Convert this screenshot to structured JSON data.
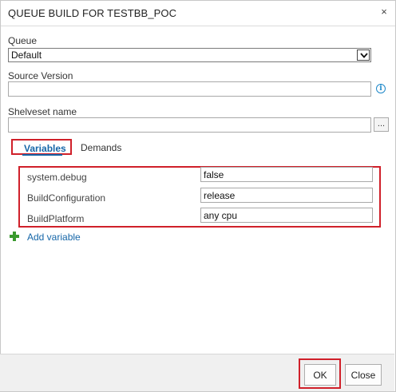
{
  "dialog": {
    "title": "QUEUE BUILD FOR TESTBB_POC",
    "close_glyph": "×"
  },
  "queue": {
    "label": "Queue",
    "selected": "Default"
  },
  "source_version": {
    "label": "Source Version",
    "value": ""
  },
  "shelveset": {
    "label": "Shelveset name",
    "value": "",
    "browse_label": "..."
  },
  "tabs": [
    {
      "label": "Variables",
      "active": true
    },
    {
      "label": "Demands",
      "active": false
    }
  ],
  "variables": [
    {
      "name": "system.debug",
      "value": "false"
    },
    {
      "name": "BuildConfiguration",
      "value": "release"
    },
    {
      "name": "BuildPlatform",
      "value": "any cpu"
    }
  ],
  "add_variable_label": "Add variable",
  "footer": {
    "ok_label": "OK",
    "close_label": "Close"
  },
  "icons": {
    "info": "info-icon",
    "plus": "plus-icon",
    "dropdown": "chevron-down-icon",
    "close": "close-icon"
  },
  "colors": {
    "accent": "#1566a8",
    "highlight": "#d0202a",
    "add": "#3a9a2e"
  }
}
